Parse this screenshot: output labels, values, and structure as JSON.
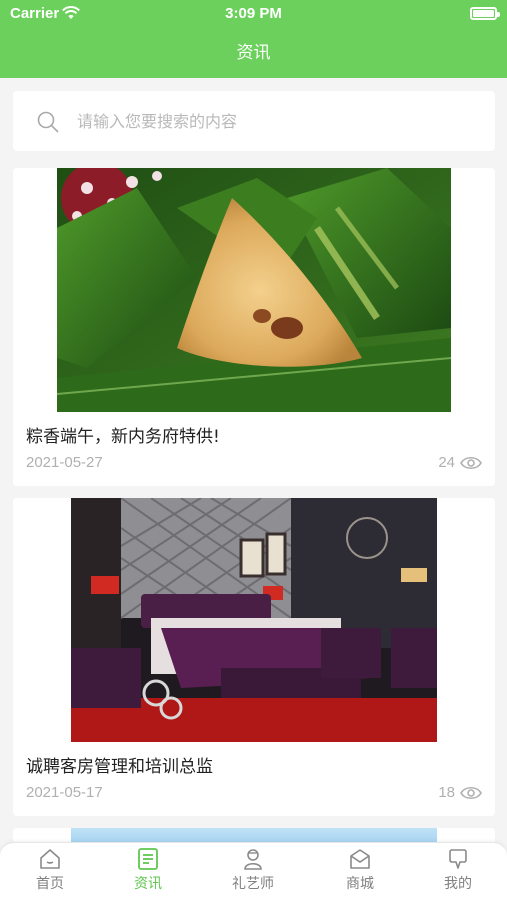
{
  "status_bar": {
    "carrier": "Carrier",
    "time": "3:09 PM"
  },
  "header": {
    "title": "资讯"
  },
  "search": {
    "placeholder": "请输入您要搜索的内容"
  },
  "articles": [
    {
      "title": "粽香端午，新内务府特供!",
      "date": "2021-05-27",
      "views": "24"
    },
    {
      "title": "诚聘客房管理和培训总监",
      "date": "2021-05-17",
      "views": "18"
    }
  ],
  "tabbar": {
    "items": [
      {
        "label": "首页",
        "icon": "home-icon"
      },
      {
        "label": "资讯",
        "icon": "news-icon",
        "active": true
      },
      {
        "label": "礼艺师",
        "icon": "person-icon"
      },
      {
        "label": "商城",
        "icon": "shop-icon"
      },
      {
        "label": "我的",
        "icon": "profile-icon"
      }
    ]
  },
  "colors": {
    "accent": "#6cd15c",
    "active_tab": "#5fc64f",
    "muted": "#b0b0b0"
  }
}
